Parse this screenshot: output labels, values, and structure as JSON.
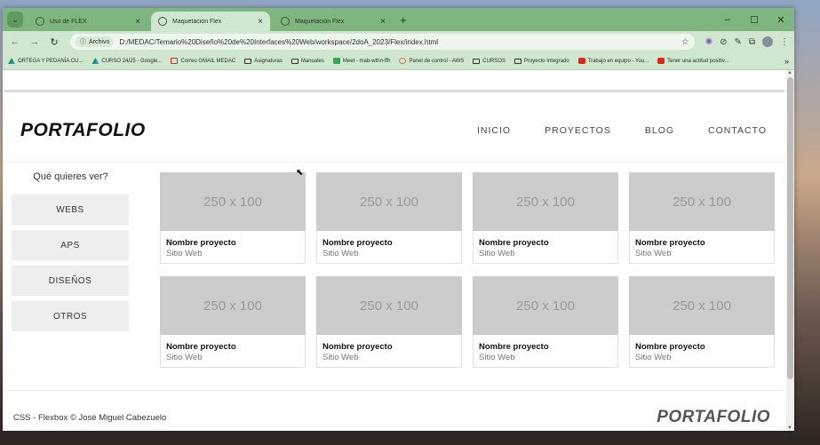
{
  "browser": {
    "tabs": [
      {
        "label": "Uso de FLEX",
        "active": false
      },
      {
        "label": "Maquetación Flex",
        "active": true
      },
      {
        "label": "Maquetación Flex",
        "active": false
      }
    ],
    "new_tab_icon": "+",
    "window_controls": {
      "minimize": "–",
      "maximize": "☐",
      "close": "✕"
    },
    "omnibox": {
      "chip_label": "Archivo",
      "url": "D:/MEDAC/Temario%20Diseño%20de%20Interfaces%20Web/workspace/2doA_2023/Flex/index.html"
    },
    "bookmarks": [
      {
        "label": "ORTEGA Y PEDANÍA CU...",
        "icon": "drive"
      },
      {
        "label": "CURSO 24/25 - Google...",
        "icon": "drive"
      },
      {
        "label": "Correo GMAIL MEDAC",
        "icon": "gmail"
      },
      {
        "label": "Asignaturas",
        "icon": "folder"
      },
      {
        "label": "Manuales",
        "icon": "folder"
      },
      {
        "label": "Meet - mab-wthn-ffh",
        "icon": "meet"
      },
      {
        "label": "Panel de control - AWS",
        "icon": "aws"
      },
      {
        "label": "CURSOS",
        "icon": "folder"
      },
      {
        "label": "Proyecto Integrado",
        "icon": "folder"
      },
      {
        "label": "Trabajo en equipo - You...",
        "icon": "yt"
      },
      {
        "label": "Tener una actitud positiv...",
        "icon": "yt"
      }
    ]
  },
  "site": {
    "logo": "PORTAFOLIO",
    "nav": [
      "INICIO",
      "PROYECTOS",
      "BLOG",
      "CONTACTO"
    ],
    "sidebar": {
      "title": "Qué quieres ver?",
      "items": [
        "WEBS",
        "APS",
        "DISEÑOS",
        "OTROS"
      ]
    },
    "cards": [
      {
        "image": "250 x 100",
        "title": "Nombre proyecto",
        "subtitle": "Sitio Web"
      },
      {
        "image": "250 x 100",
        "title": "Nombre proyecto",
        "subtitle": "Sitio Web"
      },
      {
        "image": "250 x 100",
        "title": "Nombre proyecto",
        "subtitle": "Sitio Web"
      },
      {
        "image": "250 x 100",
        "title": "Nombre proyecto",
        "subtitle": "Sitio Web"
      },
      {
        "image": "250 x 100",
        "title": "Nombre proyecto",
        "subtitle": "Sitio Web"
      },
      {
        "image": "250 x 100",
        "title": "Nombre proyecto",
        "subtitle": "Sitio Web"
      },
      {
        "image": "250 x 100",
        "title": "Nombre proyecto",
        "subtitle": "Sitio Web"
      },
      {
        "image": "250 x 100",
        "title": "Nombre proyecto",
        "subtitle": "Sitio Web"
      }
    ],
    "footer": {
      "text": "CSS - Flexbox © José Miguel Cabezuelo",
      "logo": "PORTAFOLIO"
    }
  },
  "colors": {
    "chrome_frame": "#7fb57f",
    "chrome_toolbar": "#cfe6cf",
    "placeholder_gray": "#cccccc",
    "sidebar_button": "#eeeeee"
  }
}
